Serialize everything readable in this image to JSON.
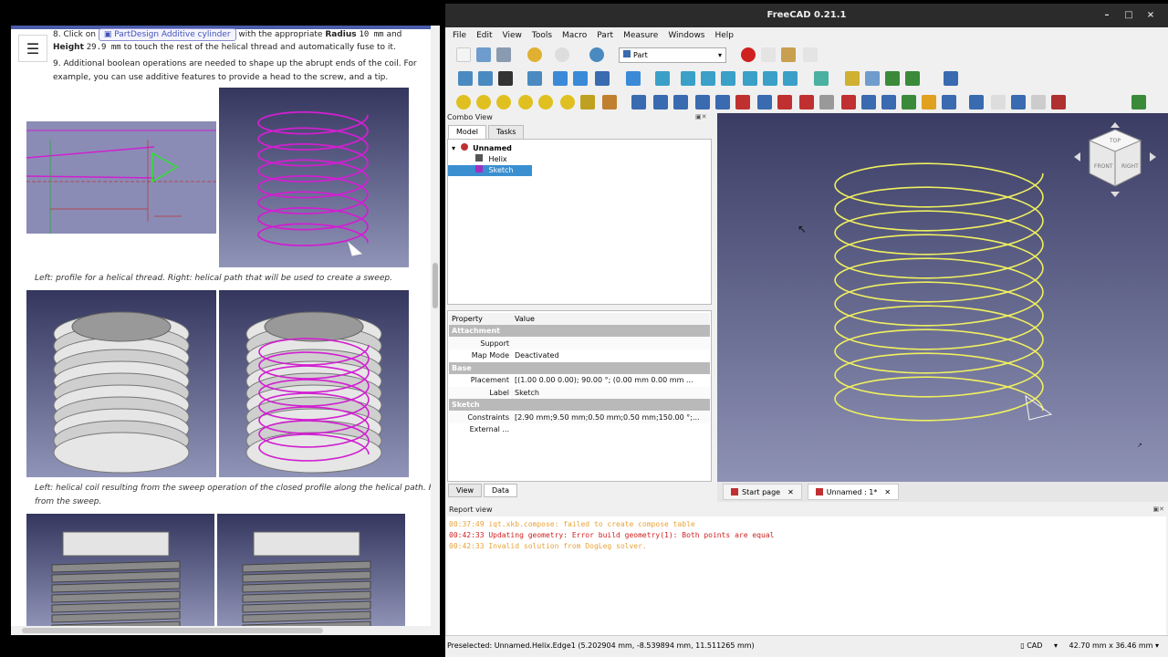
{
  "doc": {
    "step8_prefix": "8. Click on",
    "step8_button": "PartDesign Additive cylinder",
    "step8_mid": "with the appropriate",
    "radius_label": "Radius",
    "radius_value": "10 mm",
    "and": "and",
    "height_label": "Height",
    "height_value": "29.9 mm",
    "step8_suffix": "to touch the rest of the helical thread and automatically fuse to it.",
    "step9_line1": "9. Additional boolean operations are needed to shape up the abrupt ends of the coil. For",
    "step9_line2": "example, you can use additive features to provide a head to the screw, and a tip.",
    "caption1": "Left: profile for a helical thread. Right: helical path that will be used to create a sweep.",
    "caption2_line1": "Left: helical coil resulting from the sweep operation of the closed profile along the helical path. Right: s",
    "caption2_line2": "from the sweep."
  },
  "window": {
    "title": "FreeCAD 0.21.1",
    "minimize": "–",
    "maximize": "□",
    "close": "×"
  },
  "menu": [
    "File",
    "Edit",
    "View",
    "Tools",
    "Macro",
    "Part",
    "Measure",
    "Windows",
    "Help"
  ],
  "workbench": "Part",
  "combo": {
    "title": "Combo View",
    "tabs": [
      "Model",
      "Tasks"
    ],
    "tree": {
      "root": "Unnamed",
      "children": [
        "Helix",
        "Sketch"
      ]
    },
    "prop_header": {
      "property": "Property",
      "value": "Value"
    },
    "rows": [
      {
        "g": "Attachment"
      },
      {
        "n": "Support",
        "v": ""
      },
      {
        "n": "Map Mode",
        "v": "Deactivated"
      },
      {
        "g": "Base"
      },
      {
        "n": "Placement",
        "v": "[(1.00 0.00 0.00); 90.00 °; (0.00 mm  0.00 mm  ..."
      },
      {
        "n": "Label",
        "v": "Sketch"
      },
      {
        "g": "Sketch"
      },
      {
        "n": "Constraints",
        "v": "[2.90 mm;9.50 mm;0.50 mm;0.50 mm;150.00 °;..."
      },
      {
        "n": "External ...",
        "v": ""
      }
    ],
    "bottom_tabs": [
      "View",
      "Data"
    ]
  },
  "view_tabs": [
    "Start page",
    "Unnamed : 1*"
  ],
  "report": {
    "title": "Report view",
    "lines": [
      {
        "t": "00:37:49  iqt.xkb.compose: failed to create compose table",
        "c": "#e8a33a"
      },
      {
        "t": "00:42:33  Updating geometry: Error build geometry(1): Both points are equal",
        "c": "#d02020"
      },
      {
        "t": "00:42:33  Invalid solution from DogLeg solver.",
        "c": "#e8a33a"
      }
    ]
  },
  "status": {
    "left": "Preselected: Unnamed.Helix.Edge1 (5.202904 mm, -8.539894 mm, 11.511265 mm)",
    "cad": "CAD",
    "dims": "42.70 mm x 36.46 mm"
  },
  "colors": {
    "helix_3d": "#f0f060",
    "helix_doc": "#d020d0",
    "selection": "#3a8fd0"
  }
}
